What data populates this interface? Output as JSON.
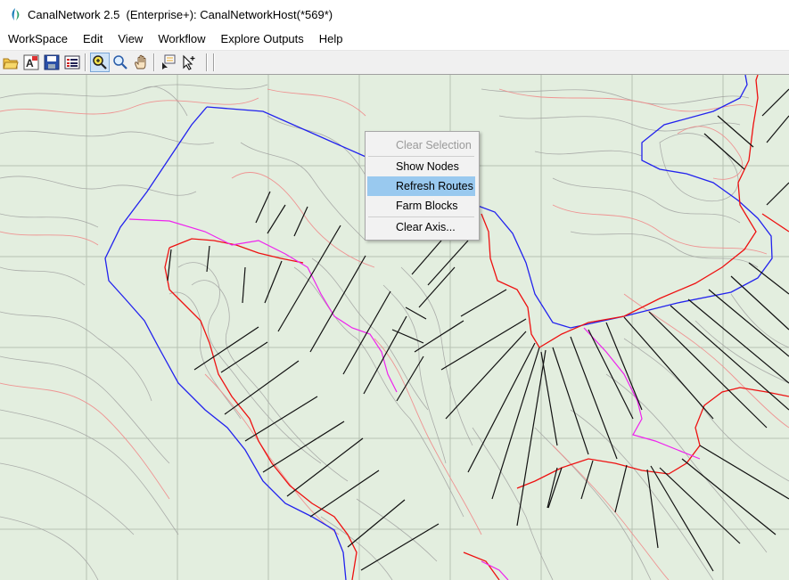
{
  "window": {
    "title": "CanalNetwork 2.5  (Enterprise+): CanalNetworkHost(*569*)"
  },
  "menu": {
    "items": [
      "WorkSpace",
      "Edit",
      "View",
      "Workflow",
      "Explore Outputs",
      "Help"
    ]
  },
  "toolbar": {
    "buttons": [
      {
        "name": "open-folder-icon"
      },
      {
        "name": "font-icon"
      },
      {
        "name": "save-icon"
      },
      {
        "name": "properties-icon"
      },
      {
        "name": "zoom-in-icon"
      },
      {
        "name": "zoom-icon"
      },
      {
        "name": "pan-hand-icon"
      },
      {
        "name": "add-node-icon"
      },
      {
        "name": "select-pointer-icon"
      }
    ]
  },
  "context_menu": {
    "items": [
      {
        "label": "Clear Selection",
        "enabled": false
      },
      {
        "label": "Show Nodes",
        "enabled": true
      },
      {
        "label": "Refresh Routes",
        "enabled": true,
        "highlighted": true
      },
      {
        "label": "Farm Blocks",
        "enabled": true
      },
      {
        "label": "Clear Axis...",
        "enabled": true
      }
    ]
  },
  "map": {
    "colors": {
      "background": "#e3eedf",
      "contour": "#9c9c9c",
      "contour_major": "#f08a8a",
      "boundary": "#2222ee",
      "canal_red": "#ee1111",
      "canal_magenta": "#ee22ee",
      "laterals": "#111111",
      "grid": "#b7c2b3"
    }
  }
}
